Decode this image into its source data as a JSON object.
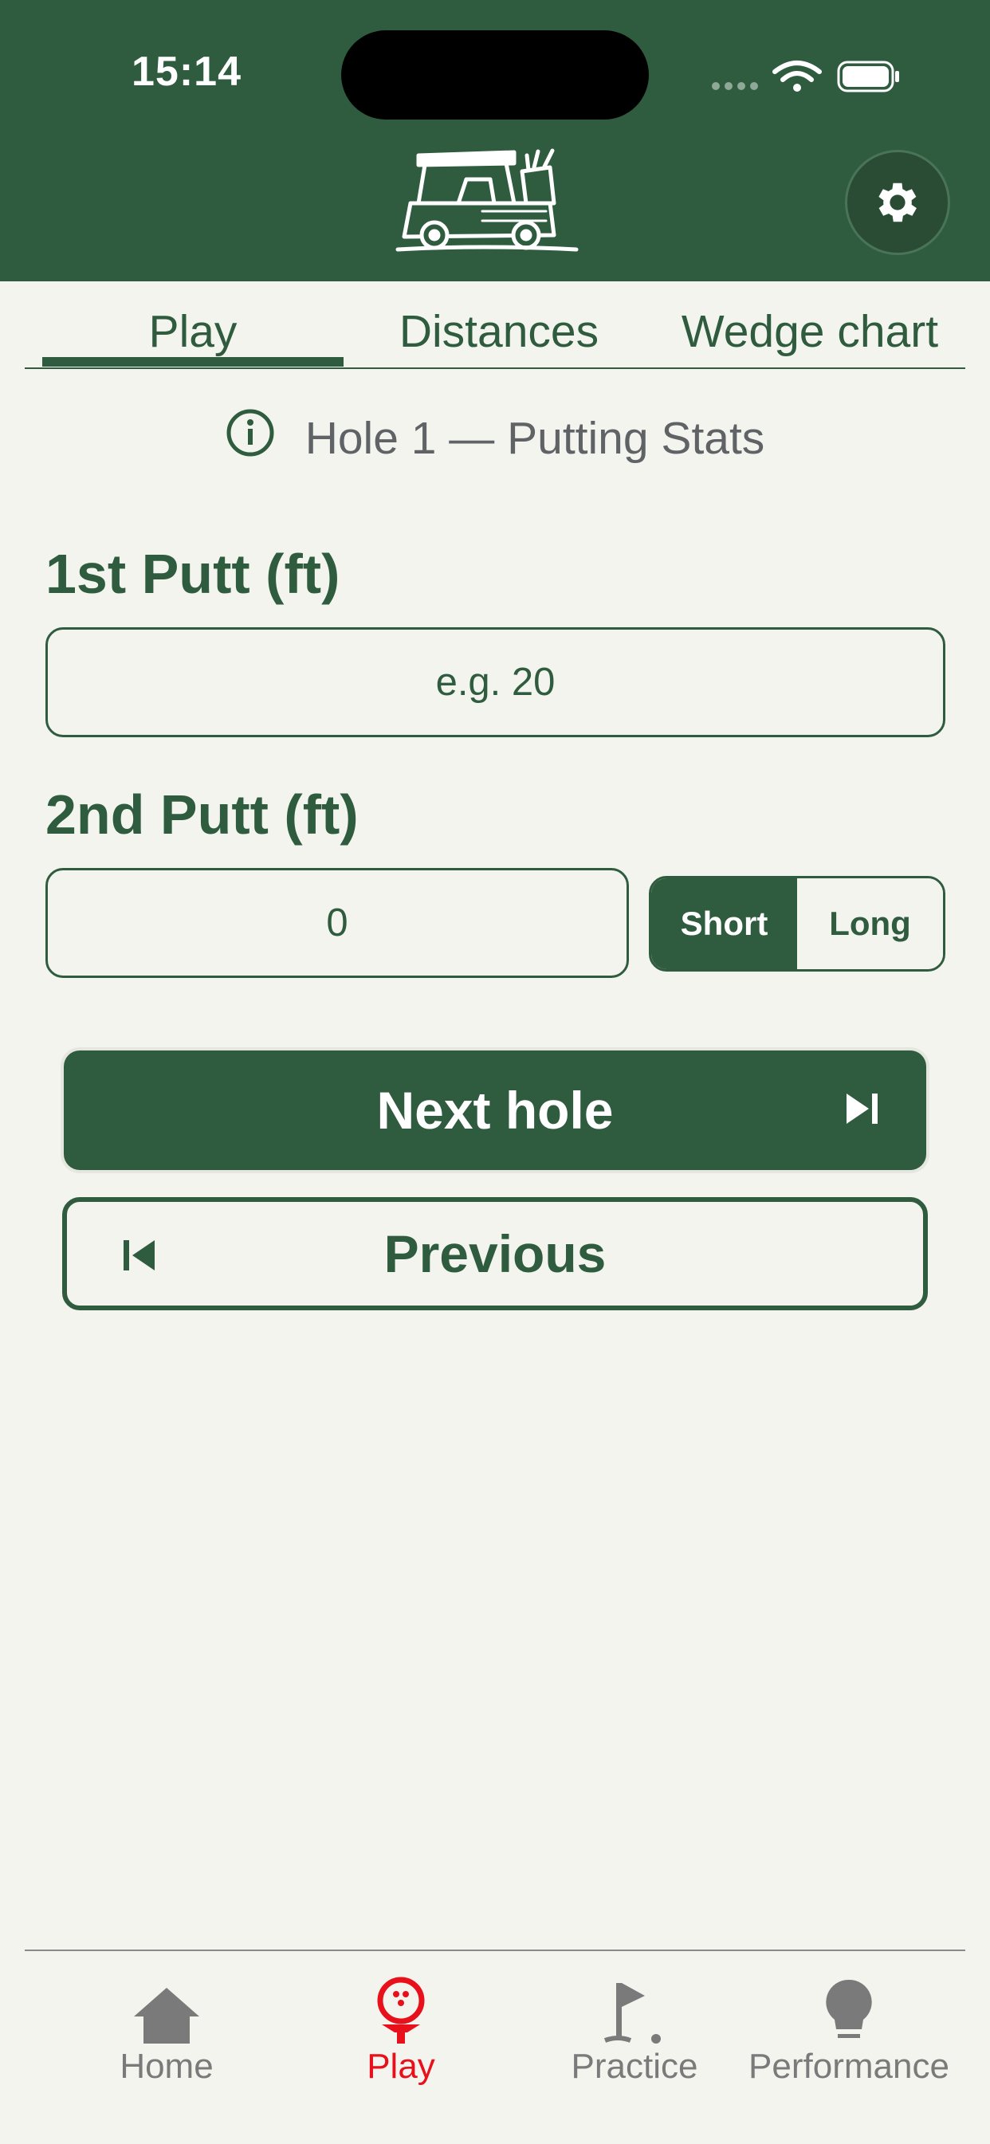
{
  "status_bar": {
    "time": "15:14"
  },
  "header": {
    "logo": "golf-cart-logo",
    "settings_icon": "gear-icon"
  },
  "tabs": [
    {
      "label": "Play",
      "selected": true
    },
    {
      "label": "Distances",
      "selected": false
    },
    {
      "label": "Wedge chart",
      "selected": false
    }
  ],
  "info": {
    "icon": "info-icon",
    "text": "Hole 1 — Putting Stats"
  },
  "form": {
    "first_putt_label": "1st Putt (ft)",
    "first_putt_placeholder": "e.g. 20",
    "first_putt_value": "",
    "second_putt_label": "2nd Putt (ft)",
    "second_putt_value": "0",
    "segment": {
      "options": [
        "Short",
        "Long"
      ],
      "selected": "Short"
    }
  },
  "buttons": {
    "next_label": "Next hole",
    "previous_label": "Previous"
  },
  "tabbar": {
    "items": [
      {
        "label": "Home",
        "icon": "house-icon",
        "active": false
      },
      {
        "label": "Play",
        "icon": "golf-ball-tee-icon",
        "active": true
      },
      {
        "label": "Practice",
        "icon": "flag-hole-icon",
        "active": false
      },
      {
        "label": "Performance",
        "icon": "lightbulb-icon",
        "active": false
      }
    ]
  },
  "colors": {
    "brand_green": "#2f5c3e",
    "background": "#f4f4ef",
    "active_tab_red": "#e8101a",
    "inactive_gray": "#7a7a7a"
  }
}
